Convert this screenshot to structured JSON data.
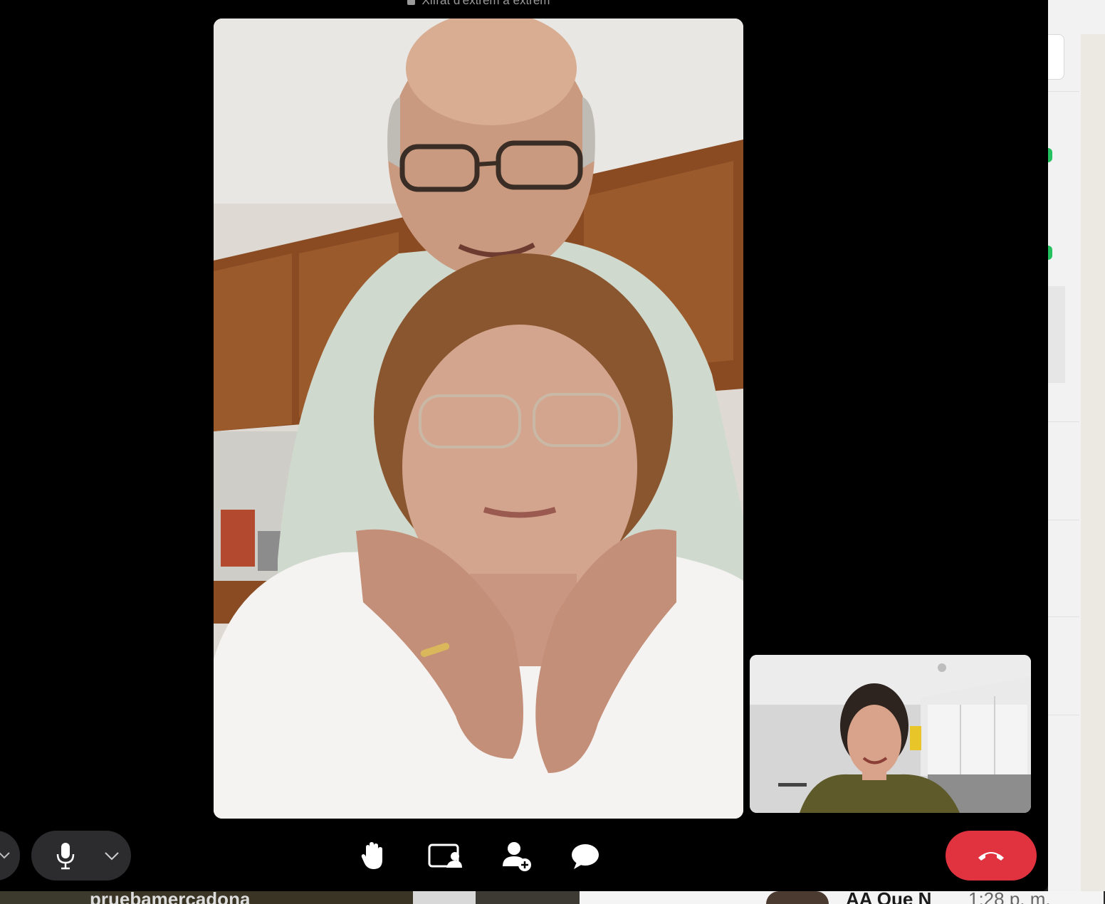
{
  "call": {
    "encryption_text": "Xifrat d'extrem a extrem"
  },
  "controls": {
    "left_partial_icon": "chevron-down-icon",
    "mic_icon": "microphone-icon",
    "mic_options_icon": "chevron-down-icon",
    "raise_hand_icon": "raise-hand-icon",
    "share_screen_icon": "screen-share-icon",
    "add_participant_icon": "add-person-icon",
    "chat_icon": "chat-bubble-icon",
    "end_call_icon": "phone-hangup-icon"
  },
  "background": {
    "bottom_left_text": "pruebamercadona",
    "bottom_right_name": "AA Que N",
    "bottom_right_time": "1:28 p. m."
  },
  "colors": {
    "end_call": "#e0333f",
    "control_pill": "#2c2c2e",
    "window": "#000000",
    "online_dot": "#25c160"
  }
}
